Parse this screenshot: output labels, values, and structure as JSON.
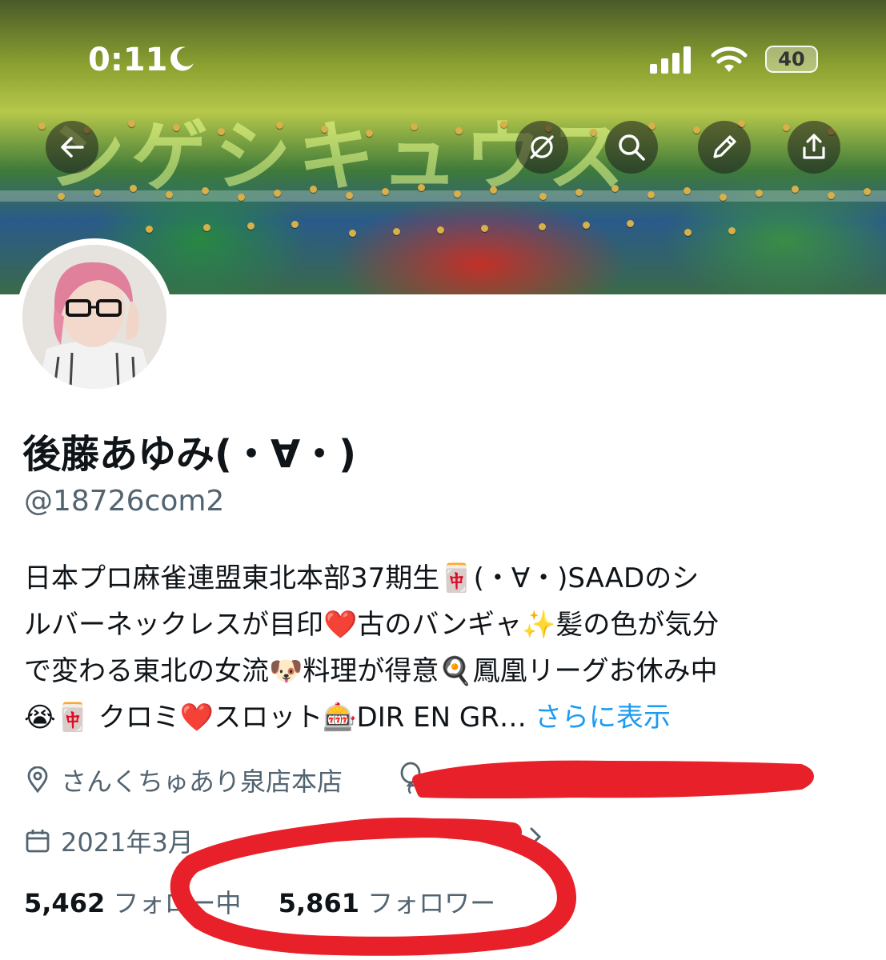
{
  "status_bar": {
    "time": "0:11",
    "battery": "40"
  },
  "banner": {
    "glow_text": "ンゲシキュウス"
  },
  "header": {
    "buttons": [
      "back-arrow-icon",
      "mute-icon",
      "search-icon",
      "pencil-icon",
      "share-icon"
    ]
  },
  "profile": {
    "name": "後藤あゆみ(・∀・)",
    "handle": "@18726com2",
    "bio_lines": [
      "日本プロ麻雀連盟東北本部37期生🀄(・∀・)SAADのシ",
      "ルバーネックレスが目印❤️古のバンギャ✨髪の色が気分",
      "で変わる東北の女流🐶料理が得意🍳鳳凰リーグお休み中",
      "😭🀄 クロミ❤️スロット🎰DIR EN GR…"
    ],
    "show_more": "さらに表示",
    "location": "さんくちゅあり泉店本店",
    "joined": "2021年3月",
    "following_count": "5,462",
    "following_label": "フォロー中",
    "followers_count": "5,861",
    "followers_label": "フォロワー"
  },
  "colors": {
    "link": "#1d9bf0",
    "secondary_text": "#536471",
    "annotation_red": "#e8202a"
  }
}
